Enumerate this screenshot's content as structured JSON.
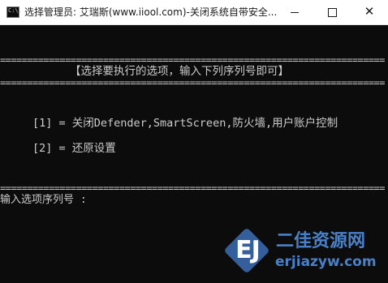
{
  "window": {
    "title": "选择管理员:  艾瑞斯(www.iiool.com)-关闭系统自带安全...",
    "icon": "console-icon",
    "icon_glyph": "C:\\.",
    "controls": {
      "minimize": "minimize-icon",
      "maximize": "maximize-icon",
      "close": "close-icon",
      "close_glyph": "✕"
    }
  },
  "console": {
    "rule_top": "=======================================================================",
    "heading": "【选择要执行的选项，输入下列序列号即可】",
    "rule_mid": "=======================================================================",
    "options": [
      "[1] = 关闭Defender,SmartScreen,防火墙,用户账户控制",
      "[2] = 还原设置"
    ],
    "rule_bottom": "=======================================================================",
    "prompt": "输入选项序列号 :"
  },
  "watermark": {
    "logo_text": "EJ",
    "title": "二佳资源网",
    "url": "erjiazyw.com"
  },
  "colors": {
    "console_background": "#0c0c0c",
    "console_text": "#cccccc",
    "titlebar_background": "#ffffff",
    "watermark_blue": "#4a80c8"
  }
}
